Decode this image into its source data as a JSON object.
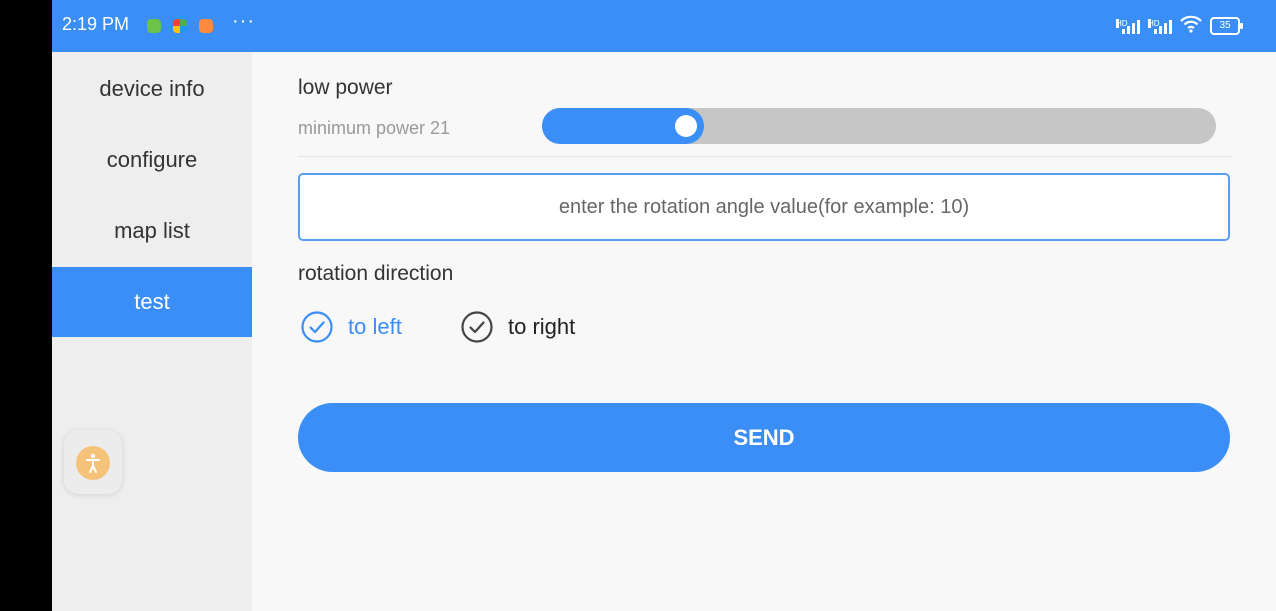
{
  "status_bar": {
    "time": "2:19 PM",
    "more": "···",
    "battery": "35",
    "icons": [
      "app-green-icon",
      "app-multicolor-icon",
      "app-orange-icon",
      "signal-hd-icon",
      "signal-hd-icon",
      "wifi-icon",
      "battery-icon"
    ]
  },
  "sidebar": {
    "items": [
      {
        "label": "device info",
        "active": false
      },
      {
        "label": "configure",
        "active": false
      },
      {
        "label": "map list",
        "active": false
      },
      {
        "label": "test",
        "active": true
      }
    ]
  },
  "power": {
    "title": "low power",
    "min_label": "minimum power 21",
    "slider_fraction": 0.24
  },
  "angle_input": {
    "placeholder": "enter the rotation angle value(for example: 10)",
    "value": ""
  },
  "direction": {
    "label": "rotation direction",
    "options": [
      {
        "label": "to left",
        "selected": true
      },
      {
        "label": "to right",
        "selected": false
      }
    ]
  },
  "send_label": "SEND",
  "colors": {
    "accent": "#3a8ef6",
    "sidebar_bg": "#eeeeee",
    "page_bg": "#f8f8f8",
    "track": "#c6c6c6",
    "fab_icon": "#f5c27a"
  }
}
